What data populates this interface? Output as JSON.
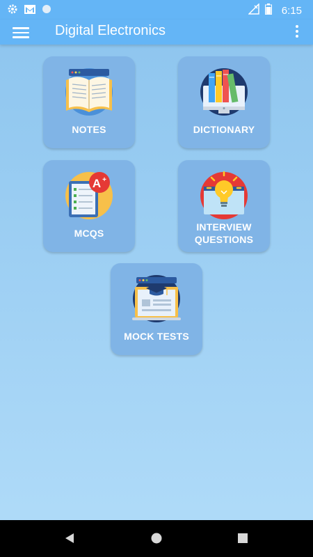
{
  "status_bar": {
    "time": "6:15",
    "left_icons": [
      "settings-icon",
      "gmail-icon",
      "circle-icon"
    ],
    "right_icons": [
      "no-signal-icon",
      "battery-icon"
    ]
  },
  "app_bar": {
    "title": "Digital Electronics",
    "menu_icon": "hamburger-menu-icon",
    "overflow_icon": "more-vert-icon"
  },
  "tiles": [
    {
      "label": "NOTES",
      "icon": "open-book-icon"
    },
    {
      "label": "DICTIONARY",
      "icon": "books-on-monitor-icon"
    },
    {
      "label": "MCQS",
      "icon": "checklist-a-plus-icon"
    },
    {
      "label_line1": "INTERVIEW",
      "label_line2": "QUESTIONS",
      "icon": "lightbulb-icon"
    },
    {
      "label": "MOCK TESTS",
      "icon": "graduation-cap-laptop-icon"
    }
  ],
  "nav_bar": {
    "back_icon": "back-triangle-icon",
    "home_icon": "home-circle-icon",
    "recents_icon": "recents-square-icon"
  },
  "colors": {
    "app_bar": "#64b5f6",
    "tile": "#80b4e6",
    "background_top": "#8cc4ee",
    "background_bottom": "#b1dcf9"
  }
}
